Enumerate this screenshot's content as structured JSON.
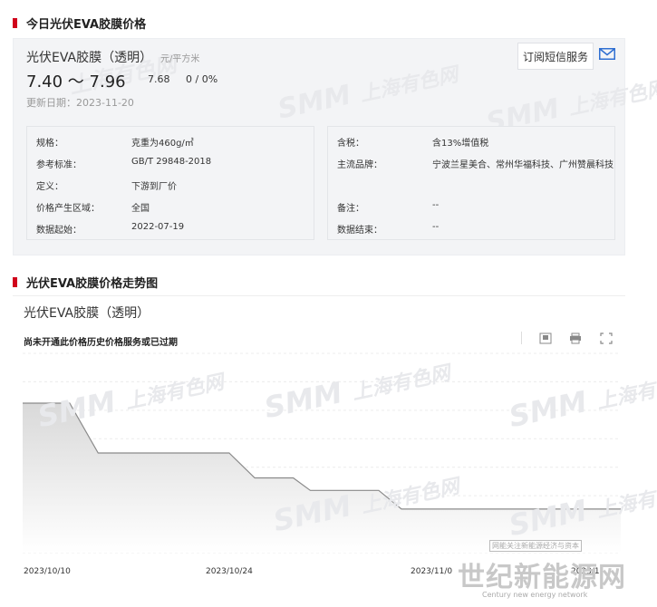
{
  "section1": {
    "title": "今日光伏EVA胶膜价格"
  },
  "card": {
    "product_name": "光伏EVA胶膜（透明）",
    "unit": "元/平方米",
    "price_range": "7.40 ～ 7.96",
    "average": "7.68",
    "change": "0 / 0%",
    "date_label": "更新日期：2023-11-20",
    "subscribe_label": "订阅短信服务",
    "mail_icon": "envelope-icon"
  },
  "info_left": [
    {
      "k": "规格：",
      "v": "克重为460g/㎡"
    },
    {
      "k": "参考标准：",
      "v": "GB/T 29848-2018"
    },
    {
      "k": "定义：",
      "v": "下游到厂价"
    },
    {
      "k": "价格产生区域：",
      "v": "全国"
    },
    {
      "k": "数据起始：",
      "v": "2022-07-19"
    }
  ],
  "info_right": [
    {
      "k": "含税：",
      "v": "含13%增值税"
    },
    {
      "k": "主流品牌：",
      "v": "宁波兰星美合、常州华福科技、广州赞晨科技"
    },
    {
      "k": "备注：",
      "v": "--"
    },
    {
      "k": "数据结束：",
      "v": "--"
    }
  ],
  "section2": {
    "title": "光伏EVA胶膜价格走势图"
  },
  "chart_panel": {
    "name": "光伏EVA胶膜（透明）",
    "notice": "尚未开通此价格历史价格服务或已过期",
    "tools": [
      "download-icon",
      "print-icon",
      "fullscreen-icon"
    ]
  },
  "watermark": {
    "brand": "SMM",
    "name": "上海有色网"
  },
  "footer": {
    "logo_text": "世纪新能源网",
    "logo_sub": "Century new energy network",
    "logo_small": "网能关注新能源经济与资本"
  },
  "chart_data": {
    "type": "area",
    "x": [
      "2023/10/10",
      "2023/10/24",
      "2023/11/07",
      "2023/11/20"
    ],
    "x_tick_labels": [
      "2023/10/10",
      "2023/10/24",
      "2023/11/0",
      "2023/1"
    ],
    "x_range_days": [
      0,
      42
    ],
    "step_points": [
      {
        "day": 0,
        "y": 8.7
      },
      {
        "day": 3.3,
        "y": 8.7
      },
      {
        "day": 5.3,
        "y": 8.3
      },
      {
        "day": 14.5,
        "y": 8.3
      },
      {
        "day": 16.3,
        "y": 8.1
      },
      {
        "day": 19.0,
        "y": 8.1
      },
      {
        "day": 20.2,
        "y": 8.0
      },
      {
        "day": 25.0,
        "y": 8.0
      },
      {
        "day": 26.6,
        "y": 7.85
      },
      {
        "day": 42,
        "y": 7.85
      }
    ],
    "ylim": [
      7.5,
      9.1
    ],
    "grid": true,
    "title": "",
    "xlabel": "",
    "ylabel": ""
  }
}
